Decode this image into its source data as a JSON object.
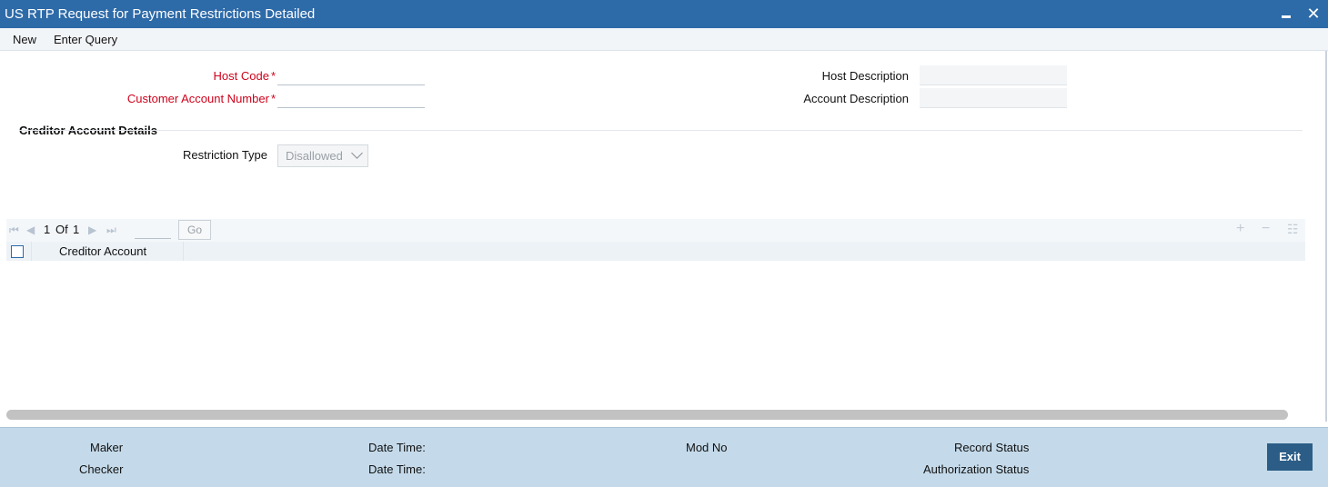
{
  "window": {
    "title": "US RTP Request for Payment Restrictions Detailed"
  },
  "menu": {
    "new": "New",
    "enter_query": "Enter Query"
  },
  "form": {
    "host_code_label": "Host Code",
    "customer_account_label": "Customer Account Number",
    "required_mark": "*",
    "host_description_label": "Host Description",
    "account_description_label": "Account Description",
    "host_code_value": "",
    "customer_account_value": "",
    "host_description_value": "",
    "account_description_value": ""
  },
  "section": {
    "title": "Creditor Account Details",
    "restriction_type_label": "Restriction Type",
    "restriction_type_value": "Disallowed"
  },
  "grid": {
    "page_current": "1",
    "page_of": "Of",
    "page_total": "1",
    "go_label": "Go",
    "columns": [
      "Creditor Account"
    ],
    "rows": []
  },
  "footer": {
    "maker": "Maker",
    "checker": "Checker",
    "date_time_1": "Date Time:",
    "date_time_2": "Date Time:",
    "mod_no": "Mod No",
    "record_status": "Record Status",
    "authorization_status": "Authorization Status",
    "exit": "Exit"
  },
  "colors": {
    "titlebar": "#2d6aa8",
    "required": "#d0021b",
    "footer": "#c4daea",
    "exit_button": "#2b5d87"
  }
}
